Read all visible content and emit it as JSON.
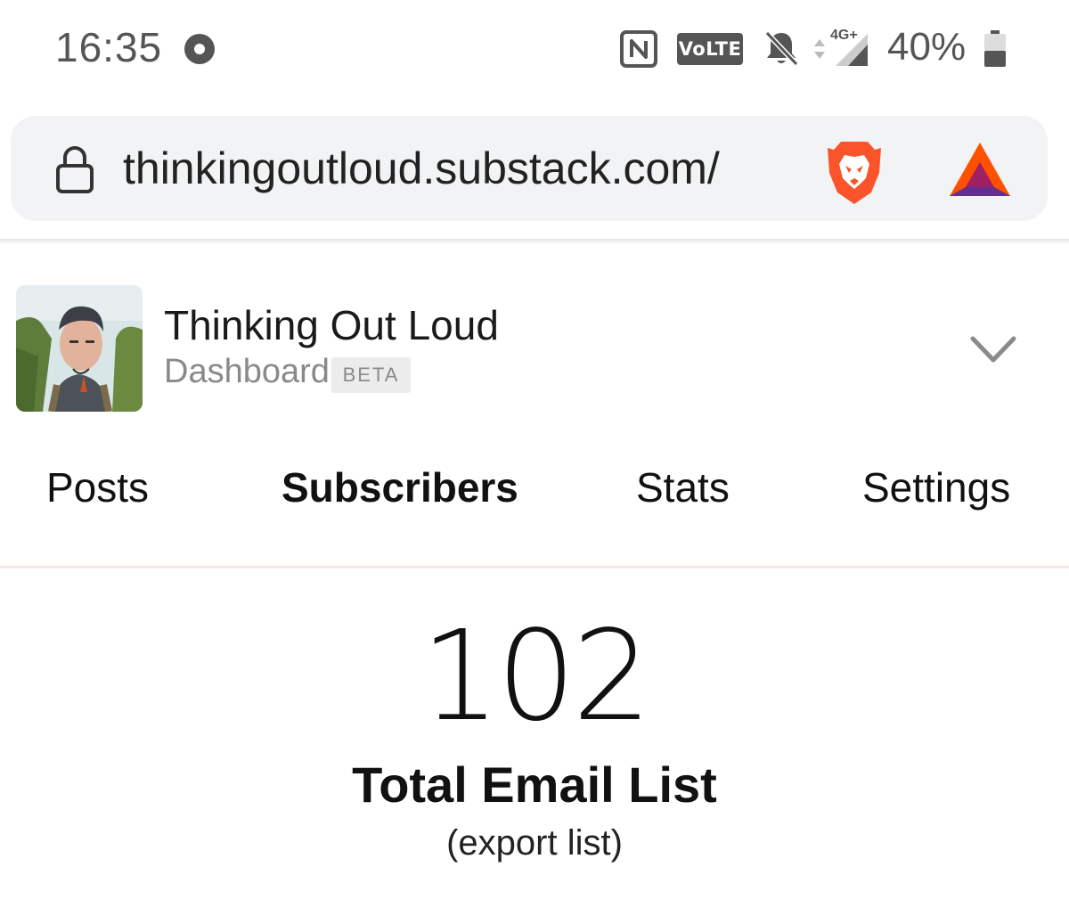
{
  "status_bar": {
    "time": "16:35",
    "volte_label": "VoLTE",
    "network_label": "4G+",
    "battery_percent": "40%",
    "battery_level": 0.4,
    "icons": [
      "record-dot-icon",
      "nfc-icon",
      "volte-icon",
      "bell-off-icon",
      "data-arrows-icon",
      "signal-icon",
      "battery-icon"
    ]
  },
  "browser": {
    "url": "thinkingoutloud.substack.com/",
    "icons": [
      "lock-icon",
      "brave-lion-icon",
      "bat-triangle-icon"
    ]
  },
  "publication": {
    "title": "Thinking Out Loud",
    "subtitle": "Dashboard",
    "badge": "BETA"
  },
  "tabs": [
    {
      "label": "Posts",
      "active": false
    },
    {
      "label": "Subscribers",
      "active": true
    },
    {
      "label": "Stats",
      "active": false
    },
    {
      "label": "Settings",
      "active": false
    }
  ],
  "stats": {
    "total_count": "102",
    "total_label": "Total Email List",
    "export_link": "(export list)"
  },
  "colors": {
    "brave_orange": "#fb542b",
    "bat_purple": "#662d91",
    "bat_orange": "#ff5000",
    "divider": "#fbe7e0",
    "url_bar_bg": "#f1f3f4"
  }
}
